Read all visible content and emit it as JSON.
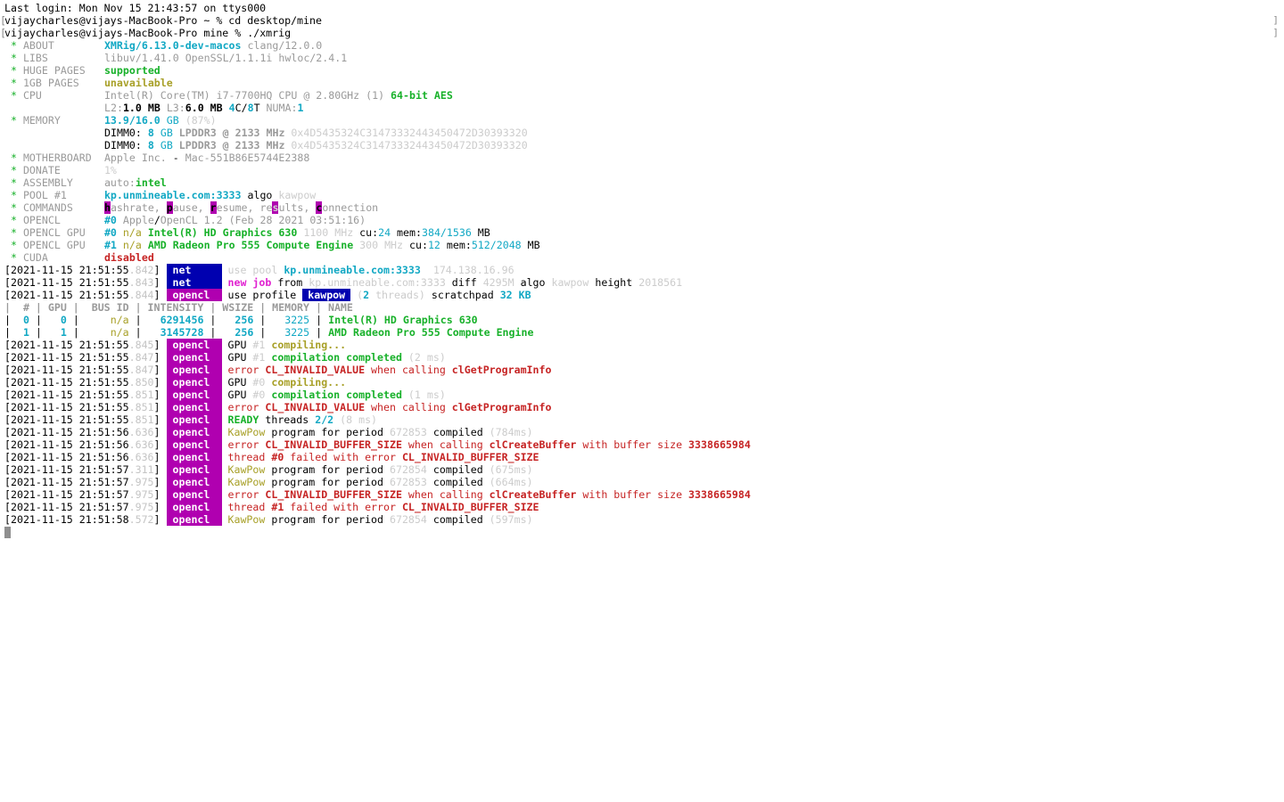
{
  "terminal": {
    "last_login": "Last login: Mon Nov 15 21:43:57 on ttys000",
    "prompts": [
      {
        "prompt": "vijaycharles@vijays-MacBook-Pro ~ % ",
        "command": "cd desktop/mine"
      },
      {
        "prompt": "vijaycharles@vijays-MacBook-Pro mine % ",
        "command": "./xmrig"
      }
    ]
  },
  "summary": {
    "about": {
      "key": "ABOUT",
      "version": "XMRig/6.13.0-dev-macos",
      "compiler": "clang/12.0.0"
    },
    "libs": {
      "key": "LIBS",
      "value": "libuv/1.41.0 OpenSSL/1.1.1i hwloc/2.4.1"
    },
    "huge_pages": {
      "key": "HUGE PAGES",
      "value": "supported"
    },
    "gb_pages": {
      "key": "1GB PAGES",
      "value": "unavailable"
    },
    "cpu": {
      "key": "CPU",
      "model": "Intel(R) Core(TM) i7-7700HQ CPU @ 2.80GHz (1)",
      "flags": "64-bit AES",
      "l2": "L2:",
      "l2v": "1.0 MB",
      "l3": " L3:",
      "l3v": "6.0 MB",
      "cores": "4",
      "c": "C",
      "slash": "/",
      "threads": "8",
      "t": "T",
      "numa": " NUMA:",
      "numav": "1"
    },
    "memory": {
      "key": "MEMORY",
      "used": "13.9/16.0",
      "unit": " GB",
      "pct": " (87%)",
      "dimms": [
        {
          "label": "DIMM0: ",
          "size": "8",
          "unit": " GB",
          "spec": " LPDDR3 @ 2133 MHz",
          "id": " 0x4D5435324C3147333244345047 2D30393320"
        },
        {
          "label": "DIMM0: ",
          "size": "8",
          "unit": " GB",
          "spec": " LPDDR3 @ 2133 MHz",
          "id": " 0x4D5435324C3147333244345047 2D30393320"
        }
      ]
    },
    "motherboard": {
      "key": "MOTHERBOARD",
      "vendor": "Apple Inc.",
      "dash": " - ",
      "model": "Mac-551B86E5744E2388"
    },
    "donate": {
      "key": "DONATE",
      "value": "1%"
    },
    "assembly": {
      "key": "ASSEMBLY",
      "prefix": "auto:",
      "value": "intel"
    },
    "pool": {
      "key": "POOL #1",
      "url": "kp.unmineable.com:3333",
      "algo_label": " algo ",
      "algo": "kawpow"
    },
    "commands": {
      "key": "COMMANDS",
      "items": [
        {
          "hot": "h",
          "rest": "ashrate, "
        },
        {
          "hot": "p",
          "rest": "ause, "
        },
        {
          "hot": "r",
          "rest": "esume, "
        },
        {
          "pre": "re",
          "hot": "s",
          "rest": "ults, "
        },
        {
          "hot": "c",
          "rest": "onnection"
        }
      ]
    },
    "opencl": {
      "key": "OPENCL",
      "id": "#0",
      "vendor": " Apple",
      "slash": "/",
      "version": "OpenCL 1.2 (Feb 28 2021 03:51:16)"
    },
    "opencl_gpus": [
      {
        "key": "OPENCL GPU",
        "id": "#0",
        "bus": " n/a ",
        "name": "Intel(R) HD Graphics 630",
        "clock": " 1100 MHz",
        "cu_label": " cu:",
        "cu": "24",
        "mem_label": " mem:",
        "mem": "384/1536",
        "mem_unit": " MB"
      },
      {
        "key": "OPENCL GPU",
        "id": "#1",
        "bus": " n/a ",
        "name": "AMD Radeon Pro 555 Compute Engine",
        "clock": " 300 MHz",
        "cu_label": " cu:",
        "cu": "12",
        "mem_label": " mem:",
        "mem": "512/2048",
        "mem_unit": " MB"
      }
    ],
    "cuda": {
      "key": "CUDA",
      "value": "disabled"
    }
  },
  "log_head": [
    {
      "date": "[2021-11-15 21:51:55",
      "ms": ".842",
      "tag": "net"
    },
    {
      "date": "[2021-11-15 21:51:55",
      "ms": ".843",
      "tag": "net"
    },
    {
      "date": "[2021-11-15 21:51:55",
      "ms": ".844",
      "tag": "opencl"
    }
  ],
  "net1": {
    "a": "use pool ",
    "pool": "kp.unmineable.com:3333",
    "ip": "  174.138.16.96"
  },
  "net2": {
    "new": "new ",
    "job": "job",
    "from": " from ",
    "pool": "kp.unmineable.com:3333",
    "diff": " diff ",
    "diffv": "4295M",
    "algo": " algo ",
    "algov": "kawpow",
    "height": " height ",
    "heightv": "2018561"
  },
  "ocl1": {
    "a": "use profile ",
    "profile": "kawpow",
    "threads": " (",
    "tn": "2",
    "tt": " threads)",
    "scratch": " scratchpad ",
    "size": "32 KB"
  },
  "gpu_table": {
    "header": "|  # | GPU |  BUS ID | INTENSITY | WSIZE | MEMORY | NAME",
    "rows": [
      {
        "idx": "0",
        "gpu": "0",
        "bus": "n/a",
        "intensity": "6291456",
        "wsize": "256",
        "memory": "3225",
        "name": "Intel(R) HD Graphics 630"
      },
      {
        "idx": "1",
        "gpu": "1",
        "bus": "n/a",
        "intensity": "3145728",
        "wsize": "256",
        "memory": "3225",
        "name": "AMD Radeon Pro 555 Compute Engine"
      }
    ]
  },
  "log": [
    {
      "date": "[2021-11-15 21:51:55",
      "ms": ".845",
      "tag": "opencl",
      "kind": "compiling",
      "gpu": "#1",
      "text": "compiling..."
    },
    {
      "date": "[2021-11-15 21:51:55",
      "ms": ".847",
      "tag": "opencl",
      "kind": "compiled",
      "gpu": "#1",
      "text": "compilation completed",
      "dur": " (2 ms)"
    },
    {
      "date": "[2021-11-15 21:51:55",
      "ms": ".847",
      "tag": "opencl",
      "kind": "err_prog",
      "code": "CL_INVALID_VALUE",
      "fn": "clGetProgramInfo"
    },
    {
      "date": "[2021-11-15 21:51:55",
      "ms": ".850",
      "tag": "opencl",
      "kind": "compiling",
      "gpu": "#0",
      "text": "compiling..."
    },
    {
      "date": "[2021-11-15 21:51:55",
      "ms": ".851",
      "tag": "opencl",
      "kind": "compiled",
      "gpu": "#0",
      "text": "compilation completed",
      "dur": " (1 ms)"
    },
    {
      "date": "[2021-11-15 21:51:55",
      "ms": ".851",
      "tag": "opencl",
      "kind": "err_prog",
      "code": "CL_INVALID_VALUE",
      "fn": "clGetProgramInfo"
    },
    {
      "date": "[2021-11-15 21:51:55",
      "ms": ".851",
      "tag": "opencl",
      "kind": "ready",
      "threads": "2/2",
      "dur": " (8 ms)"
    },
    {
      "date": "[2021-11-15 21:51:56",
      "ms": ".636",
      "tag": "opencl",
      "kind": "kawpow",
      "period": "672853",
      "dur": " (784ms)"
    },
    {
      "date": "[2021-11-15 21:51:56",
      "ms": ".636",
      "tag": "opencl",
      "kind": "err_buf",
      "code": "CL_INVALID_BUFFER_SIZE",
      "fn": "clCreateBuffer",
      "size": "3338665984"
    },
    {
      "date": "[2021-11-15 21:51:56",
      "ms": ".636",
      "tag": "opencl",
      "kind": "thread_fail",
      "thread": "#0",
      "code": "CL_INVALID_BUFFER_SIZE"
    },
    {
      "date": "[2021-11-15 21:51:57",
      "ms": ".311",
      "tag": "opencl",
      "kind": "kawpow",
      "period": "672854",
      "dur": " (675ms)"
    },
    {
      "date": "[2021-11-15 21:51:57",
      "ms": ".975",
      "tag": "opencl",
      "kind": "kawpow",
      "period": "672853",
      "dur": " (664ms)"
    },
    {
      "date": "[2021-11-15 21:51:57",
      "ms": ".975",
      "tag": "opencl",
      "kind": "err_buf",
      "code": "CL_INVALID_BUFFER_SIZE",
      "fn": "clCreateBuffer",
      "size": "3338665984"
    },
    {
      "date": "[2021-11-15 21:51:57",
      "ms": ".975",
      "tag": "opencl",
      "kind": "thread_fail",
      "thread": "#1",
      "code": "CL_INVALID_BUFFER_SIZE"
    },
    {
      "date": "[2021-11-15 21:51:58",
      "ms": ".572",
      "tag": "opencl",
      "kind": "kawpow",
      "period": "672854",
      "dur": " (597ms)"
    }
  ],
  "words": {
    "gpu": "GPU ",
    "error": "error ",
    "when_calling": " when calling ",
    "with_buffer": " with buffer size ",
    "ready": "READY",
    "threads": " threads ",
    "kawpow": "KawPow",
    "program_for": " program for period ",
    "compiled": " compiled",
    "thread": "thread ",
    "failed_with": " failed with error ",
    "close": "]",
    "star": " * "
  },
  "colors": {
    "net_badge": "#0000b0",
    "opencl_badge": "#b000b0",
    "green": "#18b12a",
    "cyan": "#12a8c4",
    "red": "#c62424",
    "yellow": "#a8a028",
    "grey": "#9a9a9a"
  }
}
